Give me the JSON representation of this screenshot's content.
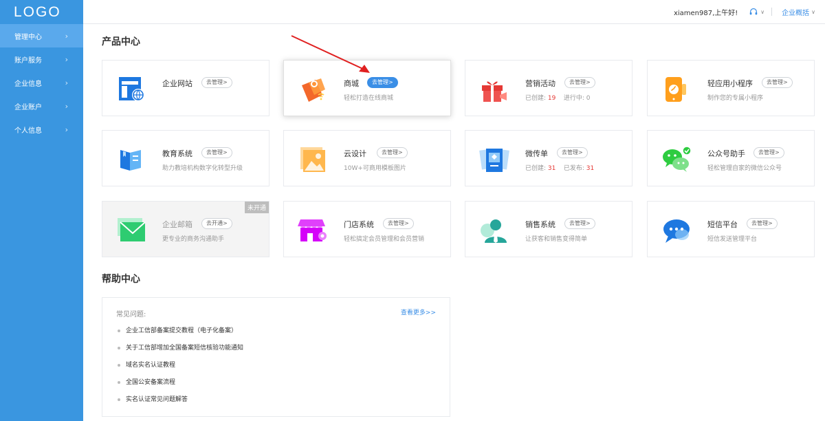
{
  "logo": "LOGO",
  "sidebar": {
    "items": [
      {
        "label": "管理中心"
      },
      {
        "label": "账户服务"
      },
      {
        "label": "企业信息"
      },
      {
        "label": "企业账户"
      },
      {
        "label": "个人信息"
      }
    ]
  },
  "header": {
    "greeting": "xiamen987,上午好!",
    "overview": "企业概括"
  },
  "product_center": {
    "title": "产品中心",
    "cards": [
      {
        "name": "企业网站",
        "manage": "去管理>",
        "desc": ""
      },
      {
        "name": "商城",
        "manage": "去管理>",
        "desc": "轻松打造在线商城"
      },
      {
        "name": "营销活动",
        "manage": "去管理>",
        "stat1_label": "已创建:",
        "stat1_value": "19",
        "stat2_label": "进行中:",
        "stat2_value": "0"
      },
      {
        "name": "轻应用小程序",
        "manage": "去管理>",
        "desc": "制作您的专属小程序"
      },
      {
        "name": "教育系统",
        "manage": "去管理>",
        "desc": "助力教培机构数字化转型升级"
      },
      {
        "name": "云设计",
        "manage": "去管理>",
        "desc": "10W+可商用模板图片"
      },
      {
        "name": "微传单",
        "manage": "去管理>",
        "stat1_label": "已创建:",
        "stat1_value": "31",
        "stat2_label": "已发布:",
        "stat2_value": "31"
      },
      {
        "name": "公众号助手",
        "manage": "去管理>",
        "desc": "轻松管理自家的微信公众号"
      },
      {
        "name": "企业邮箱",
        "manage": "去开通>",
        "desc": "更专业的商务沟通助手",
        "badge": "未开通"
      },
      {
        "name": "门店系统",
        "manage": "去管理>",
        "desc": "轻松搞定会员管理和会员营销"
      },
      {
        "name": "销售系统",
        "manage": "去管理>",
        "desc": "让获客和销售变得简单"
      },
      {
        "name": "短信平台",
        "manage": "去管理>",
        "desc": "短信发送管理平台"
      }
    ]
  },
  "help_center": {
    "title": "帮助中心",
    "faq_title": "常见问题:",
    "more": "查看更多>>",
    "items": [
      "企业工信部备案提交教程（电子化备案）",
      "关于工信部增加全国备案短信核验功能通知",
      "域名实名认证教程",
      "全国公安备案流程",
      "实名认证常见问题解答"
    ]
  },
  "colors": {
    "sidebar": "#3a96e0",
    "accent": "#3a8ee6",
    "stat": "#e53935"
  }
}
